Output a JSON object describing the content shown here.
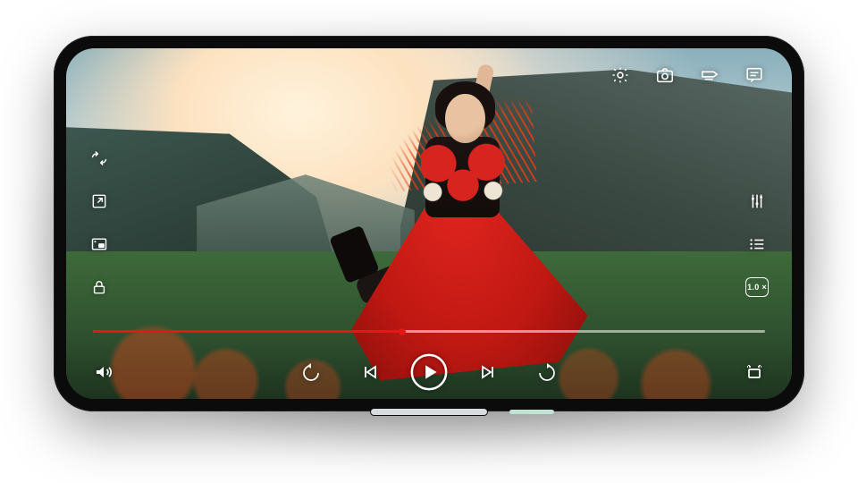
{
  "accent_color": "#e21818",
  "icon_color": "#ffffff",
  "playback": {
    "progress_percent": 46,
    "speed_label": "1.0 ×",
    "is_playing": false
  },
  "icons": {
    "top": {
      "settings": "gear-icon",
      "screenshot": "camera-icon",
      "subtitles": "subtitle-icon",
      "comments": "comment-icon"
    },
    "left": {
      "rotate": "rotate-icon",
      "popout": "popout-icon",
      "pip": "pip-icon",
      "lock": "lock-icon"
    },
    "right": {
      "equalizer": "equalizer-icon",
      "playlist": "playlist-icon",
      "speed": "speed-pill"
    },
    "bottom": {
      "volume": "volume-icon",
      "rewind": "rewind-10-icon",
      "prev": "skip-previous-icon",
      "play": "play-circle-icon",
      "next": "skip-next-icon",
      "forward": "forward-10-icon",
      "crop": "crop-icon"
    }
  }
}
